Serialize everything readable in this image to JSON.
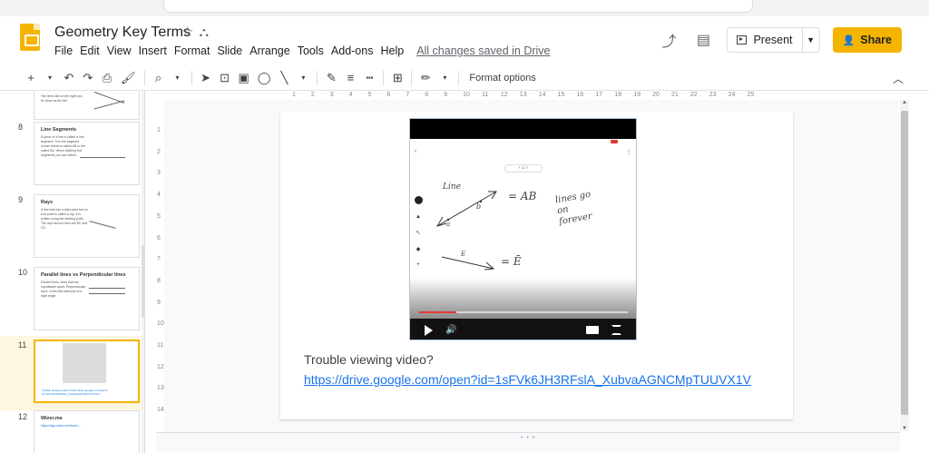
{
  "header": {
    "doc_title": "Geometry Key Terms",
    "save_status": "All changes saved in Drive",
    "present_label": "Present",
    "share_label": "Share"
  },
  "menu": [
    "File",
    "Edit",
    "View",
    "Insert",
    "Format",
    "Slide",
    "Arrange",
    "Tools",
    "Add-ons",
    "Help"
  ],
  "toolbar": {
    "format_options_label": "Format options"
  },
  "ruler_h": [
    "1",
    "2",
    "3",
    "4",
    "5",
    "6",
    "7",
    "8",
    "9",
    "10",
    "11",
    "12",
    "13",
    "14",
    "15",
    "16",
    "17",
    "18",
    "19",
    "20",
    "21",
    "22",
    "23",
    "24",
    "25"
  ],
  "ruler_v": [
    "1",
    "2",
    "3",
    "4",
    "5",
    "6",
    "7",
    "8",
    "9",
    "10",
    "11",
    "12",
    "13",
    "14"
  ],
  "filmstrip": {
    "slides": [
      {
        "num": "",
        "title": "",
        "body": "The lines like on the right can be done as the tail"
      },
      {
        "num": "8",
        "title": "Line Segments",
        "body": "A piece of a line is called a line segment. The line segment shown below is called AB or the called BA. When labeling line segments you use letters."
      },
      {
        "num": "9",
        "title": "Rays",
        "body": "A line that has a start point but no end point is called a ray. It is written using the starting point. The rays shown here are BC and CD"
      },
      {
        "num": "10",
        "title": "Parallel lines vs Perpendicular lines",
        "body": "Parallel lines: lines that are equidistant apart. Perpendicular lines: Lines that intersect at a right angle."
      },
      {
        "num": "11",
        "title": "",
        "body": "Trouble viewing video? https://drive.google.com/open?id=1sFVk6JH3RFslA_XubvaAGNCMpTUUVX1V"
      },
      {
        "num": "12",
        "title": "Wizer.me",
        "body": "https://app.wizer.me/learn/..."
      }
    ]
  },
  "slide": {
    "caption": "Trouble viewing video?",
    "link": "https://drive.google.com/open?id=1sFVk6JH3RFslA_XubvaAGNCMpTUUVX1V",
    "video": {
      "progress_fraction": 0.18,
      "handwriting": {
        "line_label": "Line",
        "eq1": "= AB",
        "note": "lines go on forever",
        "eq2": "= Ē",
        "pt_b": "b",
        "pt_a": "a",
        "pt_e": "E"
      }
    }
  },
  "colors": {
    "accent": "#f4b400",
    "link": "#1a73e8",
    "progress": "#e53935"
  }
}
